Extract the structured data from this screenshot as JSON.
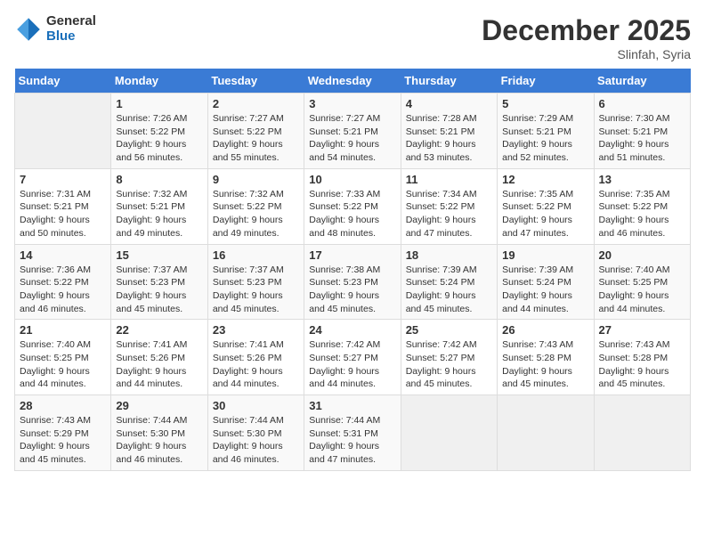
{
  "logo": {
    "general": "General",
    "blue": "Blue"
  },
  "header": {
    "title": "December 2025",
    "subtitle": "Slinfah, Syria"
  },
  "weekdays": [
    "Sunday",
    "Monday",
    "Tuesday",
    "Wednesday",
    "Thursday",
    "Friday",
    "Saturday"
  ],
  "weeks": [
    [
      {
        "day": "",
        "info": ""
      },
      {
        "day": "1",
        "info": "Sunrise: 7:26 AM\nSunset: 5:22 PM\nDaylight: 9 hours\nand 56 minutes."
      },
      {
        "day": "2",
        "info": "Sunrise: 7:27 AM\nSunset: 5:22 PM\nDaylight: 9 hours\nand 55 minutes."
      },
      {
        "day": "3",
        "info": "Sunrise: 7:27 AM\nSunset: 5:21 PM\nDaylight: 9 hours\nand 54 minutes."
      },
      {
        "day": "4",
        "info": "Sunrise: 7:28 AM\nSunset: 5:21 PM\nDaylight: 9 hours\nand 53 minutes."
      },
      {
        "day": "5",
        "info": "Sunrise: 7:29 AM\nSunset: 5:21 PM\nDaylight: 9 hours\nand 52 minutes."
      },
      {
        "day": "6",
        "info": "Sunrise: 7:30 AM\nSunset: 5:21 PM\nDaylight: 9 hours\nand 51 minutes."
      }
    ],
    [
      {
        "day": "7",
        "info": "Sunrise: 7:31 AM\nSunset: 5:21 PM\nDaylight: 9 hours\nand 50 minutes."
      },
      {
        "day": "8",
        "info": "Sunrise: 7:32 AM\nSunset: 5:21 PM\nDaylight: 9 hours\nand 49 minutes."
      },
      {
        "day": "9",
        "info": "Sunrise: 7:32 AM\nSunset: 5:22 PM\nDaylight: 9 hours\nand 49 minutes."
      },
      {
        "day": "10",
        "info": "Sunrise: 7:33 AM\nSunset: 5:22 PM\nDaylight: 9 hours\nand 48 minutes."
      },
      {
        "day": "11",
        "info": "Sunrise: 7:34 AM\nSunset: 5:22 PM\nDaylight: 9 hours\nand 47 minutes."
      },
      {
        "day": "12",
        "info": "Sunrise: 7:35 AM\nSunset: 5:22 PM\nDaylight: 9 hours\nand 47 minutes."
      },
      {
        "day": "13",
        "info": "Sunrise: 7:35 AM\nSunset: 5:22 PM\nDaylight: 9 hours\nand 46 minutes."
      }
    ],
    [
      {
        "day": "14",
        "info": "Sunrise: 7:36 AM\nSunset: 5:22 PM\nDaylight: 9 hours\nand 46 minutes."
      },
      {
        "day": "15",
        "info": "Sunrise: 7:37 AM\nSunset: 5:23 PM\nDaylight: 9 hours\nand 45 minutes."
      },
      {
        "day": "16",
        "info": "Sunrise: 7:37 AM\nSunset: 5:23 PM\nDaylight: 9 hours\nand 45 minutes."
      },
      {
        "day": "17",
        "info": "Sunrise: 7:38 AM\nSunset: 5:23 PM\nDaylight: 9 hours\nand 45 minutes."
      },
      {
        "day": "18",
        "info": "Sunrise: 7:39 AM\nSunset: 5:24 PM\nDaylight: 9 hours\nand 45 minutes."
      },
      {
        "day": "19",
        "info": "Sunrise: 7:39 AM\nSunset: 5:24 PM\nDaylight: 9 hours\nand 44 minutes."
      },
      {
        "day": "20",
        "info": "Sunrise: 7:40 AM\nSunset: 5:25 PM\nDaylight: 9 hours\nand 44 minutes."
      }
    ],
    [
      {
        "day": "21",
        "info": "Sunrise: 7:40 AM\nSunset: 5:25 PM\nDaylight: 9 hours\nand 44 minutes."
      },
      {
        "day": "22",
        "info": "Sunrise: 7:41 AM\nSunset: 5:26 PM\nDaylight: 9 hours\nand 44 minutes."
      },
      {
        "day": "23",
        "info": "Sunrise: 7:41 AM\nSunset: 5:26 PM\nDaylight: 9 hours\nand 44 minutes."
      },
      {
        "day": "24",
        "info": "Sunrise: 7:42 AM\nSunset: 5:27 PM\nDaylight: 9 hours\nand 44 minutes."
      },
      {
        "day": "25",
        "info": "Sunrise: 7:42 AM\nSunset: 5:27 PM\nDaylight: 9 hours\nand 45 minutes."
      },
      {
        "day": "26",
        "info": "Sunrise: 7:43 AM\nSunset: 5:28 PM\nDaylight: 9 hours\nand 45 minutes."
      },
      {
        "day": "27",
        "info": "Sunrise: 7:43 AM\nSunset: 5:28 PM\nDaylight: 9 hours\nand 45 minutes."
      }
    ],
    [
      {
        "day": "28",
        "info": "Sunrise: 7:43 AM\nSunset: 5:29 PM\nDaylight: 9 hours\nand 45 minutes."
      },
      {
        "day": "29",
        "info": "Sunrise: 7:44 AM\nSunset: 5:30 PM\nDaylight: 9 hours\nand 46 minutes."
      },
      {
        "day": "30",
        "info": "Sunrise: 7:44 AM\nSunset: 5:30 PM\nDaylight: 9 hours\nand 46 minutes."
      },
      {
        "day": "31",
        "info": "Sunrise: 7:44 AM\nSunset: 5:31 PM\nDaylight: 9 hours\nand 47 minutes."
      },
      {
        "day": "",
        "info": ""
      },
      {
        "day": "",
        "info": ""
      },
      {
        "day": "",
        "info": ""
      }
    ]
  ]
}
